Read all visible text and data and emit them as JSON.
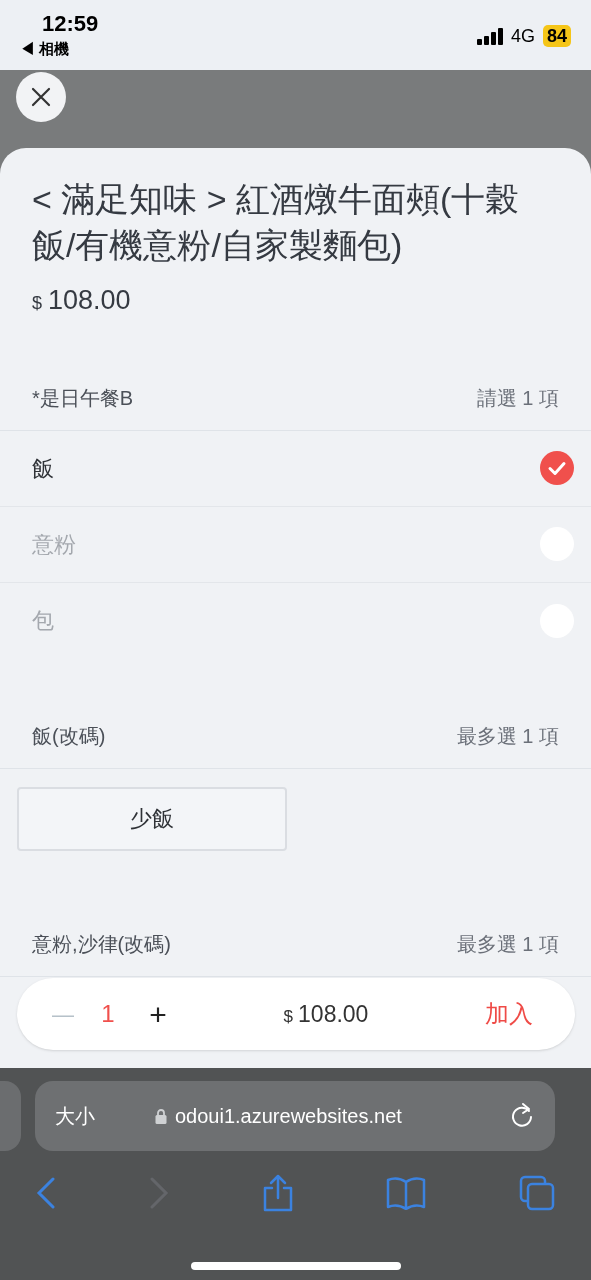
{
  "status_bar": {
    "time": "12:59",
    "back_label": "◀ 相機",
    "network": "4G",
    "battery": "84"
  },
  "item": {
    "title": "< 滿足知味 > 紅酒燉牛面頰(十穀飯/有機意粉/自家製麵包)",
    "currency": "$",
    "price": "108.00"
  },
  "groups": [
    {
      "kind": "radio",
      "name": "*是日午餐B",
      "rule": "請選 1 項",
      "options": [
        {
          "label": "飯",
          "selected": true
        },
        {
          "label": "意粉",
          "selected": false
        },
        {
          "label": "包",
          "selected": false
        }
      ]
    },
    {
      "kind": "buttons",
      "name": "飯(改碼)",
      "rule": "最多選 1 項",
      "options": [
        {
          "label": "少飯",
          "selected": false
        }
      ]
    },
    {
      "kind": "buttons",
      "name": "意粉,沙律(改碼)",
      "rule": "最多選 1 項"
    }
  ],
  "cart_bar": {
    "minus": "—",
    "quantity": "1",
    "plus": "+",
    "currency": "$",
    "total": "108.00",
    "add": "加入"
  },
  "browser": {
    "text_size": "大小",
    "url": "odoui1.azurewebsites.net"
  }
}
